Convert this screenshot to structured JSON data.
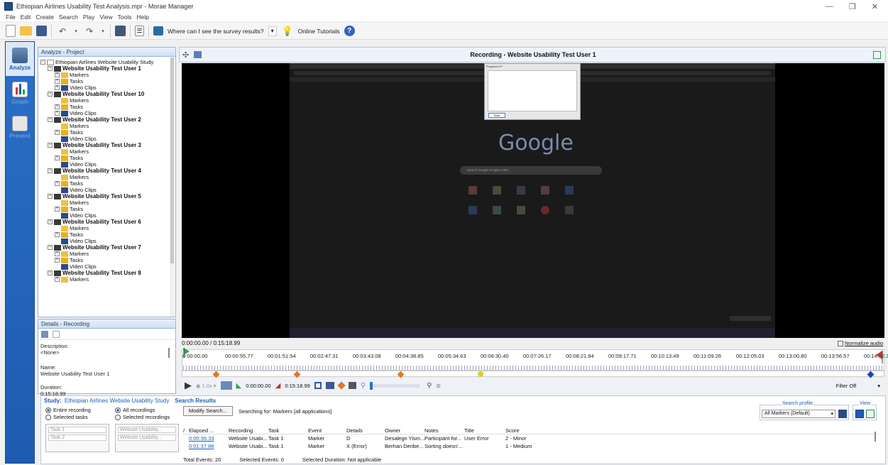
{
  "window": {
    "title": "Ethiopian Airlines Usability Test Analysis.mpr - Morae Manager"
  },
  "menu": [
    "File",
    "Edit",
    "Create",
    "Search",
    "Play",
    "View",
    "Tools",
    "Help"
  ],
  "toolbar": {
    "survey_label": "Where can I see the survey results?",
    "tutorials_label": "Online Tutorials"
  },
  "nav": {
    "analyze": "Analyze",
    "graph": "Graph",
    "present": "Present"
  },
  "project": {
    "header": "Analyze - Project",
    "study": "Ethiopian Airlines Website Usability Study",
    "users": [
      "Website Usability Test User 1",
      "Website Usability Test User 10",
      "Website Usability Test User 2",
      "Website Usability Test User 3",
      "Website Usability Test User 4",
      "Website Usability Test User 5",
      "Website Usability Test User 6",
      "Website Usability Test User 7",
      "Website Usability Test User 8"
    ],
    "children": {
      "markers": "Markers",
      "tasks": "Tasks",
      "clips": "Video Clips"
    }
  },
  "details": {
    "header": "Details - Recording",
    "description_label": "Description:",
    "description_value": "<None>",
    "name_label": "Name:",
    "name_value": "Website Usability Test User 1",
    "duration_label": "Duration:",
    "duration_value": "0:15:18.99"
  },
  "recording": {
    "title": "Recording - Website Usability Test User 1",
    "time": "0:00:00.00 / 0:15:18.99",
    "normalize": "Normalize audio",
    "ticks": [
      "0:00:00.00",
      "00:00:55.77",
      "00:01:51.54",
      "00:02:47.31",
      "00:03:43.08",
      "00:04:38.85",
      "00:05:34.63",
      "00:06:30.40",
      "00:07:26.17",
      "00:08:21.94",
      "00:09:17.71",
      "00:10:13.49",
      "00:11:09.26",
      "00:12:05.03",
      "00:13:00.80",
      "00:13:56.57",
      "00:14:52.34"
    ],
    "speed": "1.0x",
    "start_time": "0:00:00.00",
    "end_time": "0:15:18.99",
    "filter": "Filter Off"
  },
  "screen": {
    "brand": "Google",
    "search_placeholder": "Search Google or type a URL",
    "dialog_title": "Progress 0/7",
    "dialog_btn": "Start",
    "dialog_ok": "Start"
  },
  "study": {
    "label": "Study:",
    "name": "Ethiopian Airlines Website Usability Study",
    "search_results": "Search Results",
    "entire": "Entire recording",
    "selected_tasks": "Selected tasks",
    "all_recordings": "All recordings",
    "selected_recordings": "Selected recordings",
    "task_items": [
      "Task 1",
      "Task 2"
    ],
    "rec_items": [
      "Website Usability...",
      "Website Usability..."
    ],
    "modify": "Modify Search...",
    "searching": "Searching for: Markers [all applications]",
    "profile_label": "Search profile",
    "profile_value": "All Markers (Default)",
    "view_label": "View",
    "columns": [
      "Elapsed ...",
      "Recording",
      "Task",
      "Event",
      "Details",
      "Owner",
      "Notes",
      "Title",
      "Score"
    ],
    "rows": [
      [
        "0:00:36.33",
        "Website Usabi...",
        "Task 1",
        "Marker",
        "D",
        "Desalegn Yism...",
        "Participant for...",
        "User Error",
        "2 - Minor"
      ],
      [
        "0:01:37.88",
        "Website Usabi...",
        "Task 1",
        "Marker",
        "X (Error)",
        "Berhan Deribe...",
        "Sorting doesn'...",
        "",
        "1 - Medium"
      ]
    ],
    "total": "Total Events: 20",
    "selected": "Selected Events: 0",
    "duration": "Selected Duration: Not applicable"
  }
}
